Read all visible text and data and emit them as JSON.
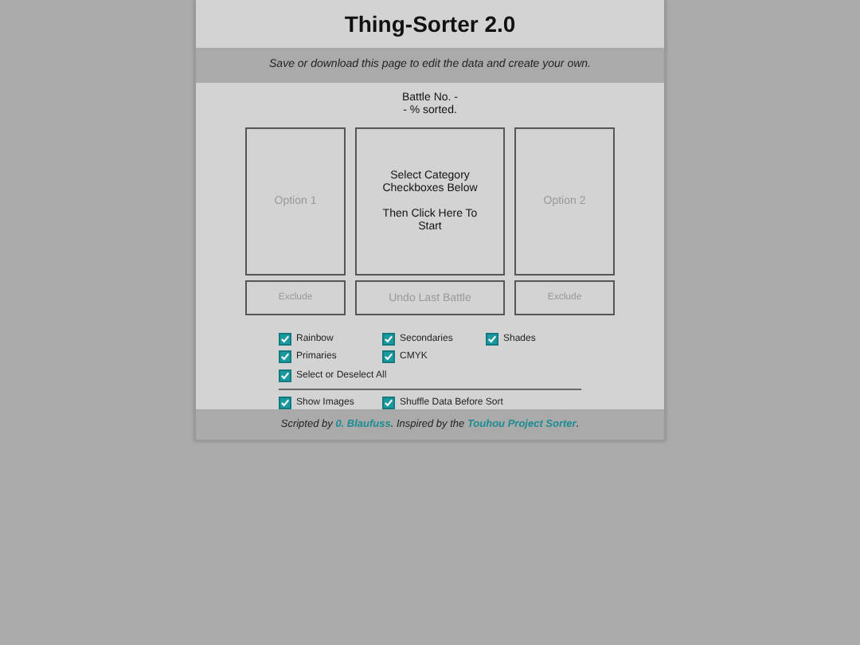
{
  "title": "Thing-Sorter 2.0",
  "banner": "Save or download this page to edit the data and create your own.",
  "progress": {
    "battle": "Battle No. -",
    "sorted": "- % sorted."
  },
  "left_option": "Option 1",
  "center_prompt": [
    "Select Category Checkboxes Below",
    "Then Click Here To Start"
  ],
  "right_option": "Option 2",
  "buttons": [
    {
      "label": "Exclude"
    },
    {
      "label": "Undo Last Battle"
    },
    {
      "label": "Exclude"
    }
  ],
  "categories": [
    {
      "label": "Rainbow",
      "checked": true
    },
    {
      "label": "Secondaries",
      "checked": true
    },
    {
      "label": "Shades",
      "checked": true
    },
    {
      "label": "Primaries",
      "checked": true
    },
    {
      "label": "CMYK",
      "checked": true
    }
  ],
  "select_all": {
    "label": "Select or Deselect All",
    "checked": true
  },
  "options": [
    {
      "label": "Show Images",
      "checked": true
    },
    {
      "label": "Shuffle Data Before Sort",
      "checked": true
    }
  ],
  "footer": {
    "before": "Scripted by ",
    "author_link": "0. Blaufuss",
    "middle": ". Inspired by the ",
    "source_link": "Touhou Project Sorter",
    "after": "."
  }
}
